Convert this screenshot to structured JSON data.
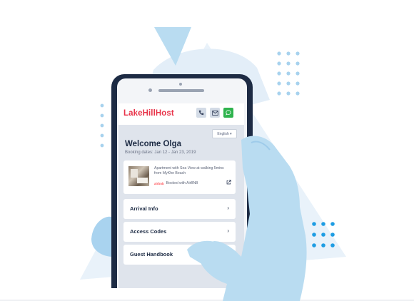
{
  "app": {
    "brand": "LakeHillHost",
    "language": "English ▾",
    "colors": {
      "brand": "#e8344a",
      "accent_green": "#2fb34e",
      "navy": "#1d2b44",
      "illustration_blue": "#b9dcf1"
    }
  },
  "header_buttons": [
    {
      "icon": "phone-icon"
    },
    {
      "icon": "mail-icon"
    },
    {
      "icon": "chat-icon"
    }
  ],
  "welcome": {
    "title": "Welcome Olga",
    "dates": "Booking dates: Jan 12 - Jan 23, 2019"
  },
  "booking_card": {
    "listing": "Apartment with Sea View at walking 5mins from MyKhe Beach",
    "source": "Booked with AirBNB",
    "source_logo": "airbnb"
  },
  "menu": [
    {
      "label": "Arrival Info",
      "chevron": "›"
    },
    {
      "label": "Access Codes",
      "chevron": "›"
    },
    {
      "label": "Guest Handbook",
      "chevron": "›"
    }
  ]
}
